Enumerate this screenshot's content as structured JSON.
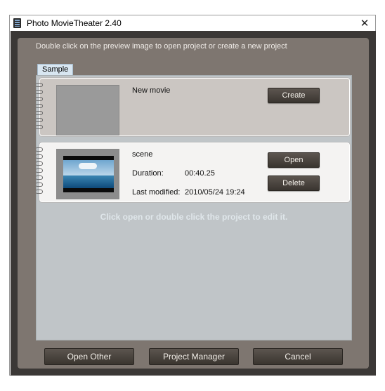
{
  "window": {
    "title": "Photo MovieTheater 2.40",
    "close_glyph": "✕",
    "icon": "film-app-icon"
  },
  "hint": "Double click on the preview image to open project or create a new project",
  "tab": {
    "label": "Sample"
  },
  "new_card": {
    "title": "New movie",
    "create_label": "Create"
  },
  "scene_card": {
    "title": "scene",
    "duration_label": "Duration:",
    "duration_value": "00:40.25",
    "modified_label": "Last modified:",
    "modified_value": "2010/05/24 19:24",
    "open_label": "Open",
    "delete_label": "Delete"
  },
  "info": "Click open or double click the project to edit it.",
  "footer": {
    "open_other_label": "Open Other",
    "project_manager_label": "Project Manager",
    "cancel_label": "Cancel"
  }
}
